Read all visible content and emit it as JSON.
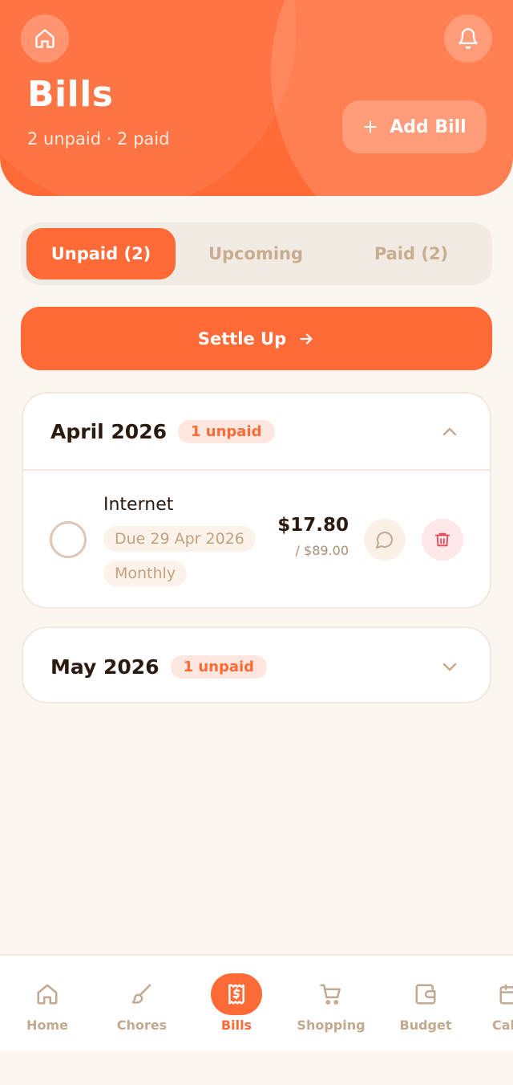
{
  "header": {
    "title": "Bills",
    "subtitle": "2 unpaid · 2 paid",
    "add_bill_label": "Add Bill"
  },
  "tabs": [
    {
      "label": "Unpaid (2)",
      "active": true
    },
    {
      "label": "Upcoming",
      "active": false
    },
    {
      "label": "Paid (2)",
      "active": false
    }
  ],
  "settle_label": "Settle Up",
  "months": [
    {
      "title": "April 2026",
      "badge": "1 unpaid",
      "expanded": true,
      "bills": [
        {
          "name": "Internet",
          "due": "Due 29 Apr 2026",
          "frequency": "Monthly",
          "amount": "$17.80",
          "total": "/ $89.00"
        }
      ]
    },
    {
      "title": "May 2026",
      "badge": "1 unpaid",
      "expanded": false
    }
  ],
  "nav": [
    {
      "label": "Home",
      "icon": "home-icon"
    },
    {
      "label": "Chores",
      "icon": "brush-icon"
    },
    {
      "label": "Bills",
      "icon": "receipt-icon",
      "active": true
    },
    {
      "label": "Shopping",
      "icon": "cart-icon"
    },
    {
      "label": "Budget",
      "icon": "wallet-icon"
    },
    {
      "label": "Cal",
      "icon": "calendar-icon"
    }
  ],
  "colors": {
    "accent": "#ff6a36",
    "background": "#fcf6f0",
    "muted": "#c2a98f",
    "danger": "#e8465a"
  }
}
